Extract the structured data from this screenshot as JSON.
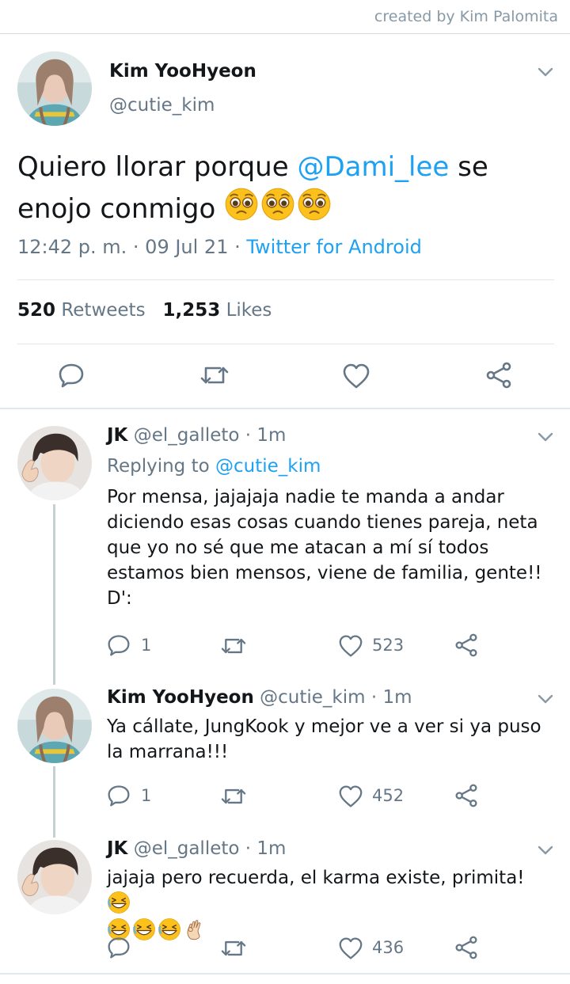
{
  "credit": "created by Kim Palomita",
  "colors": {
    "link": "#1da1f2",
    "muted": "#657786",
    "text": "#14171a",
    "divider": "#e1e8ed"
  },
  "main_tweet": {
    "name": "Kim YooHyeon",
    "handle": "@cutie_kim",
    "text_before": "Quiero llorar porque ",
    "mention": "@Dami_lee",
    "text_after": " se enojo conmigo ",
    "emoji": [
      "pleading-face-emoji",
      "pleading-face-emoji",
      "pleading-face-emoji"
    ],
    "time": "12:42 p. m. · 09 Jul 21 · ",
    "source": "Twitter for Android",
    "retweets_count": "520",
    "retweets_label": " Retweets",
    "likes_count": "1,253",
    "likes_label": " Likes",
    "actions": [
      "reply-icon",
      "retweet-icon",
      "like-icon",
      "share-icon"
    ]
  },
  "replies": [
    {
      "name": "JK",
      "handle": " @el_galleto · 1m",
      "replying_label": "Replying to ",
      "replying_to": "@cutie_kim",
      "text": "Por mensa, jajajaja nadie te manda a andar diciendo esas cosas cuando tienes pareja, neta que yo no sé que me atacan a mí sí todos estamos bien mensos, viene de familia, gente!! D':",
      "reply_count": "1",
      "like_count": "523"
    },
    {
      "name": "Kim YooHyeon",
      "handle": " @cutie_kim · 1m",
      "text": "Ya cállate, JungKook y mejor ve a ver si ya puso la marrana!!!",
      "reply_count": "1",
      "like_count": "452"
    },
    {
      "name": "JK",
      "handle": " @el_galleto · 1m",
      "text": "jajaja pero recuerda, el karma existe, primita! ",
      "emoji": [
        "grinning-squinting-emoji",
        "grinning-squinting-emoji",
        "grinning-squinting-emoji",
        "grinning-squinting-emoji",
        "ok-hand-emoji"
      ],
      "reply_count": "",
      "like_count": "436"
    }
  ]
}
